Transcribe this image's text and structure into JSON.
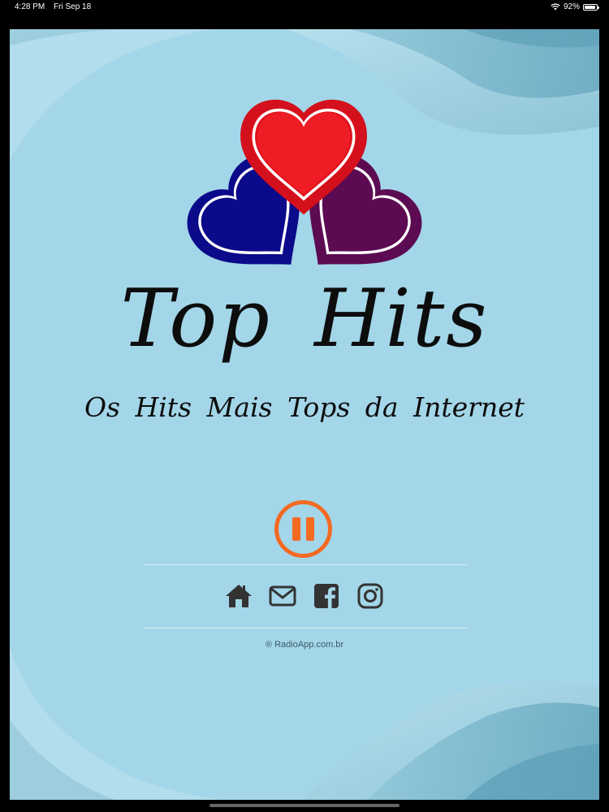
{
  "status_bar": {
    "time": "4:28 PM",
    "date": "Fri Sep 18",
    "battery": "92%",
    "battery_level": 0.92
  },
  "logo": {
    "title": "Top Hits",
    "subtitle": "Os Hits Mais Tops da Internet",
    "colors": {
      "red": "#ee1c25",
      "blue": "#0a0a8a",
      "purple": "#5c0b52"
    }
  },
  "player": {
    "state_icon": "pause-icon",
    "accent": "#f36a21"
  },
  "social": {
    "items": [
      {
        "name": "home-icon"
      },
      {
        "name": "envelope-icon"
      },
      {
        "name": "facebook-icon"
      },
      {
        "name": "instagram-icon"
      }
    ],
    "icon_color": "#333333"
  },
  "footer": {
    "text": "® RadioApp.com.br"
  }
}
